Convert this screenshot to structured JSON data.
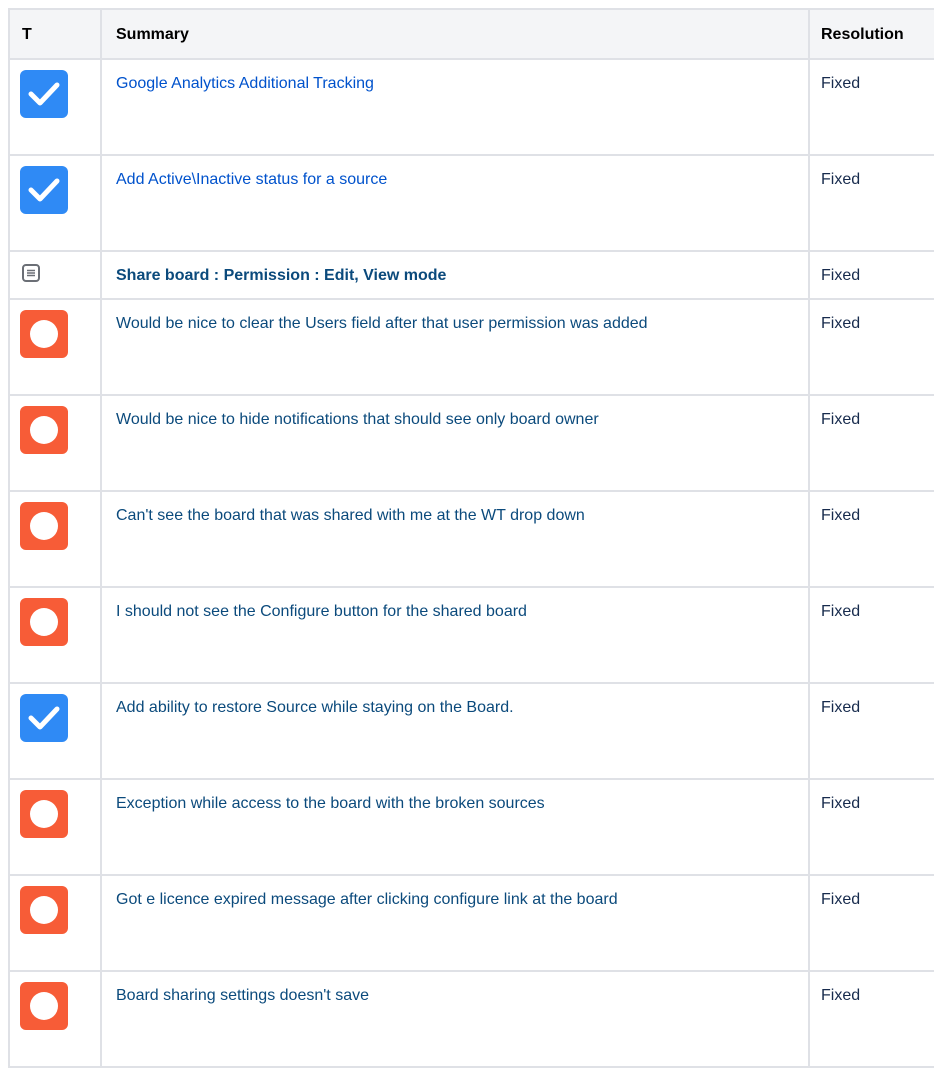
{
  "headers": {
    "type": "T",
    "summary": "Summary",
    "resolution": "Resolution"
  },
  "colors": {
    "task": "#2f8af5",
    "bug": "#f75c37",
    "link": "#0052cc",
    "border": "#dfe1e6"
  },
  "issues": [
    {
      "icon": "task-icon",
      "summary": "Google Analytics Additional Tracking",
      "resolution": "Fixed"
    },
    {
      "icon": "task-icon",
      "summary": "Add Active\\Inactive status for a source",
      "resolution": "Fixed"
    },
    {
      "icon": "story-icon",
      "summary": "Share board : Permission : Edit, View mode",
      "resolution": "Fixed"
    },
    {
      "icon": "bug-icon",
      "summary": "Would be nice to clear the Users field after that user permission was added",
      "resolution": "Fixed"
    },
    {
      "icon": "bug-icon",
      "summary": "Would be nice to hide notifications that should see only board owner",
      "resolution": "Fixed"
    },
    {
      "icon": "bug-icon",
      "summary": "Can't see the board that was shared with me at the WT drop down",
      "resolution": "Fixed"
    },
    {
      "icon": "bug-icon",
      "summary": "I should not see the Configure button for the shared board",
      "resolution": "Fixed"
    },
    {
      "icon": "task-icon",
      "summary": "Add ability to restore Source while staying on the Board.",
      "resolution": "Fixed"
    },
    {
      "icon": "bug-icon",
      "summary": "Exception while access to the board with the broken sources",
      "resolution": "Fixed"
    },
    {
      "icon": "bug-icon",
      "summary": "Got e licence expired message after clicking configure link at the board",
      "resolution": "Fixed"
    },
    {
      "icon": "bug-icon",
      "summary": "Board sharing settings doesn't save",
      "resolution": "Fixed"
    }
  ]
}
